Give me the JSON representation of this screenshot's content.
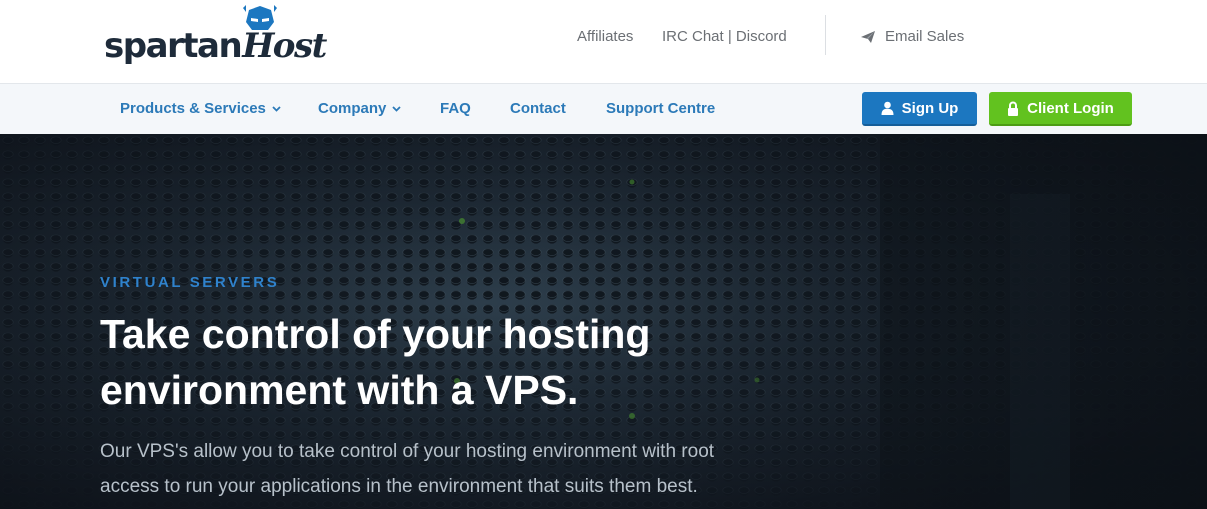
{
  "brand": {
    "name_part1": "spartan",
    "name_part2": "Host"
  },
  "toplinks": {
    "affiliates": "Affiliates",
    "chat": "IRC Chat | Discord",
    "email_sales": "Email Sales"
  },
  "nav": {
    "products": "Products & Services",
    "company": "Company",
    "faq": "FAQ",
    "contact": "Contact",
    "support": "Support Centre"
  },
  "buttons": {
    "signup": "Sign Up",
    "login": "Client Login"
  },
  "hero": {
    "eyebrow": "VIRTUAL SERVERS",
    "headline": "Take control of your hosting environment with a VPS.",
    "lead": "Our VPS's allow you to take control of your hosting environment with root access to run your applications in the environment that suits them best."
  },
  "colors": {
    "brand_blue": "#1c77c0",
    "nav_blue": "#2c7ab8",
    "login_green": "#62c21f",
    "eyebrow_blue": "#2f82cc"
  },
  "icons": [
    "spartan-helmet-logo",
    "paper-plane-icon",
    "chevron-down-icon",
    "user-icon",
    "lock-icon"
  ]
}
